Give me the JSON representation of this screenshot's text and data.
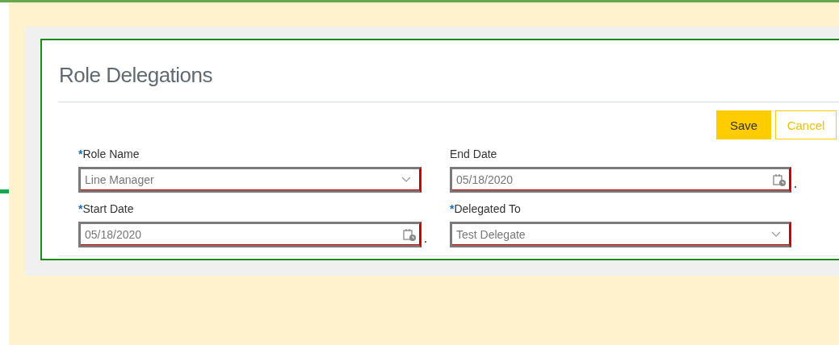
{
  "page": {
    "title": "Role Delegations"
  },
  "buttons": [
    {
      "label": "Save",
      "kind": "primary"
    },
    {
      "label": "Cancel",
      "kind": "secondary"
    }
  ],
  "fields": [
    {
      "required_mark": "*",
      "label": "Role Name",
      "kind": "select",
      "value": "Line Manager"
    },
    {
      "label": "End Date",
      "kind": "date",
      "value": "05/18/2020"
    },
    {
      "required_mark": "*",
      "label": "Start Date",
      "kind": "date",
      "value": "05/18/2020"
    },
    {
      "required_mark": "*",
      "label": "Delegated To",
      "kind": "select",
      "value": "Test Delegate"
    }
  ]
}
